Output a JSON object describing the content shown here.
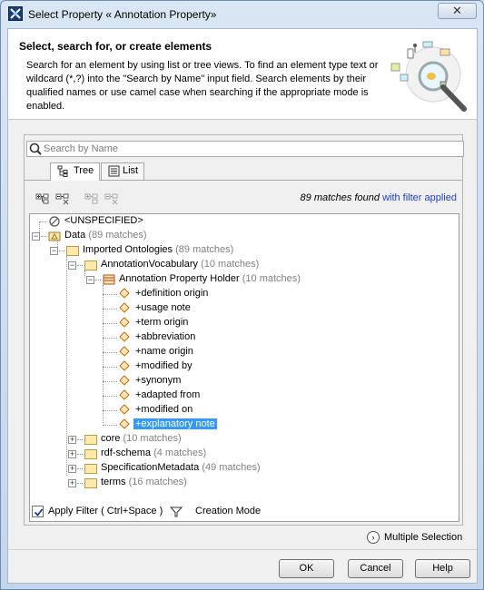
{
  "window": {
    "title": "Select Property « Annotation Property»",
    "close_label": "✕"
  },
  "header": {
    "title": "Select, search for, or create elements",
    "description": "Search for an element by using list or tree views. To find an element type text or wildcard (*,?) into the \"Search by Name\" input field. Search elements by their qualified names or use camel case when searching if the appropriate mode is enabled."
  },
  "search": {
    "placeholder": "Search by Name",
    "value": ""
  },
  "tabs": [
    {
      "label": "Tree",
      "icon": "tree-view-icon",
      "active": true
    },
    {
      "label": "List",
      "icon": "list-view-icon",
      "active": false
    }
  ],
  "toolbar": {
    "icons": [
      "expand-all-icon",
      "collapse-all-icon",
      "expand-selected-icon",
      "collapse-selected-icon"
    ]
  },
  "matches": {
    "count_text": "89 matches found",
    "filter_text": "with filter applied"
  },
  "tree": {
    "unspecified": "<UNSPECIFIED>",
    "data": {
      "label": "Data",
      "count": "(89 matches)"
    },
    "imported": {
      "label": "Imported Ontologies",
      "count": "(89 matches)"
    },
    "vocab": {
      "label": "AnnotationVocabulary",
      "count": "(10 matches)"
    },
    "holder": {
      "label": "Annotation Property Holder",
      "count": "(10 matches)"
    },
    "properties": [
      "+definition origin",
      "+usage note",
      "+term origin",
      "+abbreviation",
      "+name origin",
      "+modified by",
      "+synonym",
      "+adapted from",
      "+modified on",
      "+explanatory note"
    ],
    "siblings": [
      {
        "label": "core",
        "count": "(10 matches)"
      },
      {
        "label": "rdf-schema",
        "count": "(4 matches)"
      },
      {
        "label": "SpecificationMetadata",
        "count": "(49 matches)"
      },
      {
        "label": "terms",
        "count": "(16 matches)"
      }
    ]
  },
  "options": {
    "apply_filter": "Apply Filter ( Ctrl+Space )",
    "apply_filter_checked": true,
    "creation_mode": "Creation Mode",
    "multiple_selection": "Multiple Selection"
  },
  "buttons": {
    "ok": "OK",
    "cancel": "Cancel",
    "help": "Help"
  }
}
